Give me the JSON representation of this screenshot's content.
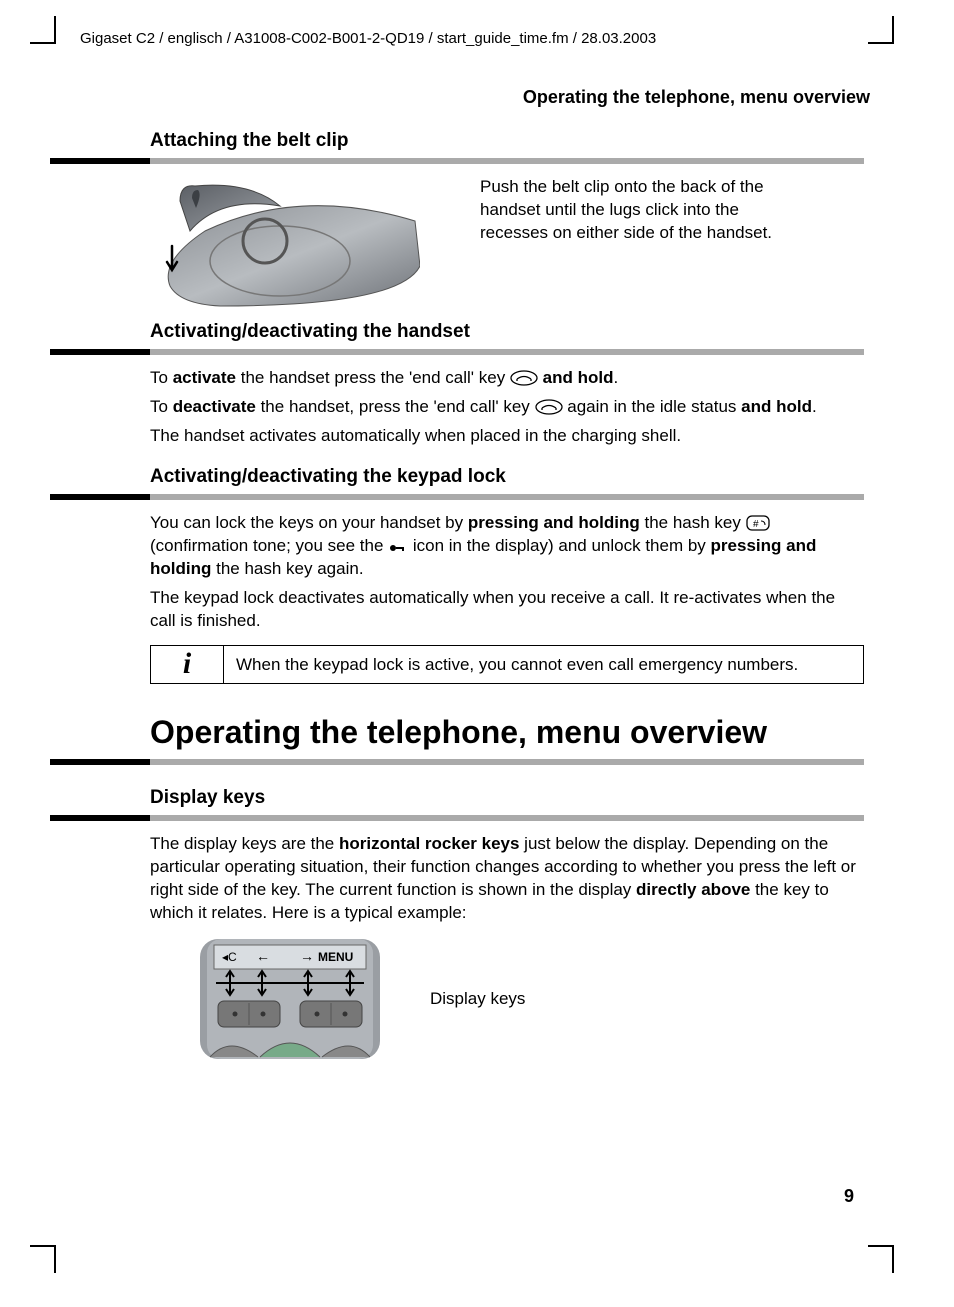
{
  "header_line": "Gigaset C2 / englisch / A31008-C002-B001-2-QD19 / start_guide_time.fm / 28.03.2003",
  "running_head": "Operating the telephone, menu overview",
  "section_beltclip": {
    "title": "Attaching the belt clip",
    "text": "Push the belt clip onto the back of the handset until the lugs click into the recesses on either side of the handset."
  },
  "section_activate_handset": {
    "title": "Activating/deactivating the handset",
    "line1_a": "To ",
    "line1_b": "activate",
    "line1_c": " the handset press the 'end call' key ",
    "line1_d": " and hold",
    "line1_e": ".",
    "line2_a": "To ",
    "line2_b": "deactivate",
    "line2_c": " the handset, press the 'end call' key ",
    "line2_d": " again in the idle status ",
    "line2_e": "and hold",
    "line2_f": ".",
    "line3": "The handset activates automatically when placed in the charging shell."
  },
  "section_keypad_lock": {
    "title": "Activating/deactivating the keypad lock",
    "p1_a": "You can lock the keys on your handset by ",
    "p1_b": "pressing and holding",
    "p1_c": " the hash key ",
    "p1_d": " (confirmation tone; you see the ",
    "p1_e": " icon in the display) and unlock them by ",
    "p1_f": "pressing and holding",
    "p1_g": " the hash key again.",
    "p2": "The keypad lock deactivates automatically when you receive a call. It re-activates when the call is finished.",
    "info_icon": "i",
    "info_text": "When the keypad lock is active, you cannot even call emergency numbers."
  },
  "chapter_title": "Operating the telephone, menu overview",
  "section_display_keys": {
    "title": "Display keys",
    "p_a": "The display keys are the ",
    "p_b": "horizontal rocker keys",
    "p_c": " just below the display. Depending on the particular operating situation, their function changes according to whether you press the left or right side of the key. The current function is shown in the display ",
    "p_d": "directly above",
    "p_e": " the key to which it relates. Here is a typical example:",
    "caption": "Display keys",
    "menu_label": "MENU"
  },
  "page_number": "9"
}
